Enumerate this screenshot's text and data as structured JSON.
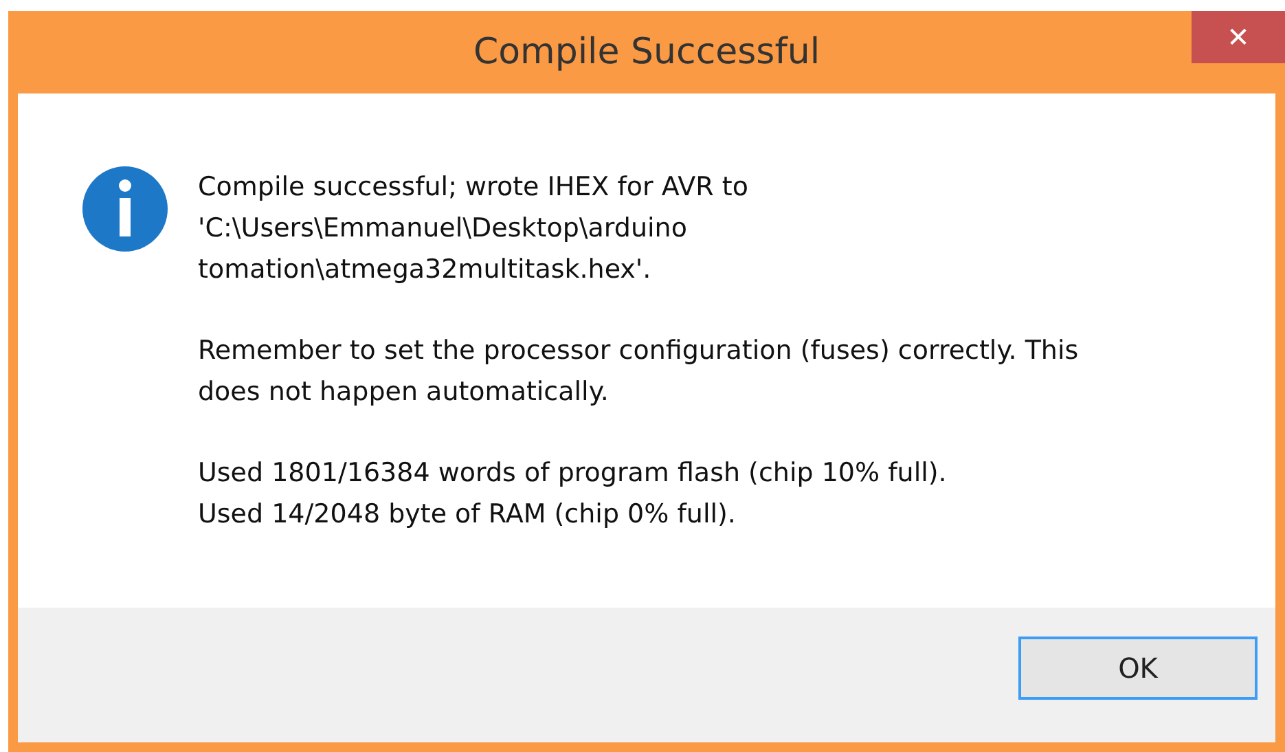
{
  "window": {
    "title": "Compile Successful",
    "close_glyph": "✕"
  },
  "message": {
    "paragraphs": [
      [
        "Compile successful; wrote IHEX for AVR to",
        "'C:\\Users\\Emmanuel\\Desktop\\arduino",
        "tomation\\atmega32multitask.hex'."
      ],
      [
        "Remember to set the processor configuration (fuses) correctly. This",
        "does not happen automatically."
      ],
      [
        "Used 1801/16384 words of program flash (chip 10% full).",
        "Used 14/2048 byte of RAM (chip 0% full)."
      ]
    ]
  },
  "buttons": [
    {
      "label": "OK",
      "focused": true
    }
  ]
}
